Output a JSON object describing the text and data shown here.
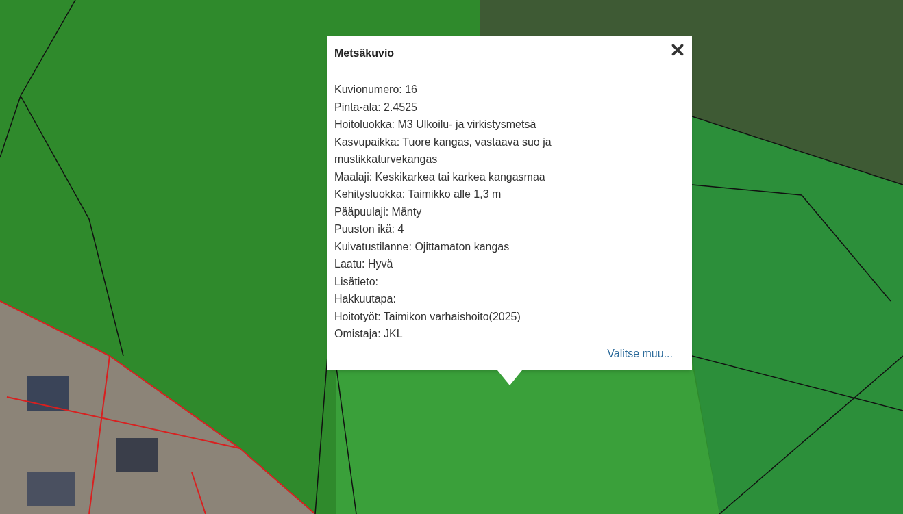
{
  "popup": {
    "title": "Metsäkuvio",
    "fields": [
      "Kuvionumero: 16",
      "Pinta-ala: 2.4525",
      "Hoitoluokka: M3 Ulkoilu- ja virkistysmetsä",
      "Kasvupaikka: Tuore kangas, vastaava suo ja mustikkaturvekangas",
      "Maalaji: Keskikarkea tai karkea kangasmaa",
      "Kehitysluokka: Taimikko alle 1,3 m",
      "Pääpuulaji: Mänty",
      "Puuston ikä: 4",
      "Kuivatustilanne: Ojittamaton kangas",
      "Laatu: Hyvä",
      "Lisätieto:",
      "Hakkuutapa:",
      "Hoitotyöt: Taimikon varhaishoito(2025)",
      "Omistaja: JKL"
    ],
    "link": "Valitse muu..."
  }
}
